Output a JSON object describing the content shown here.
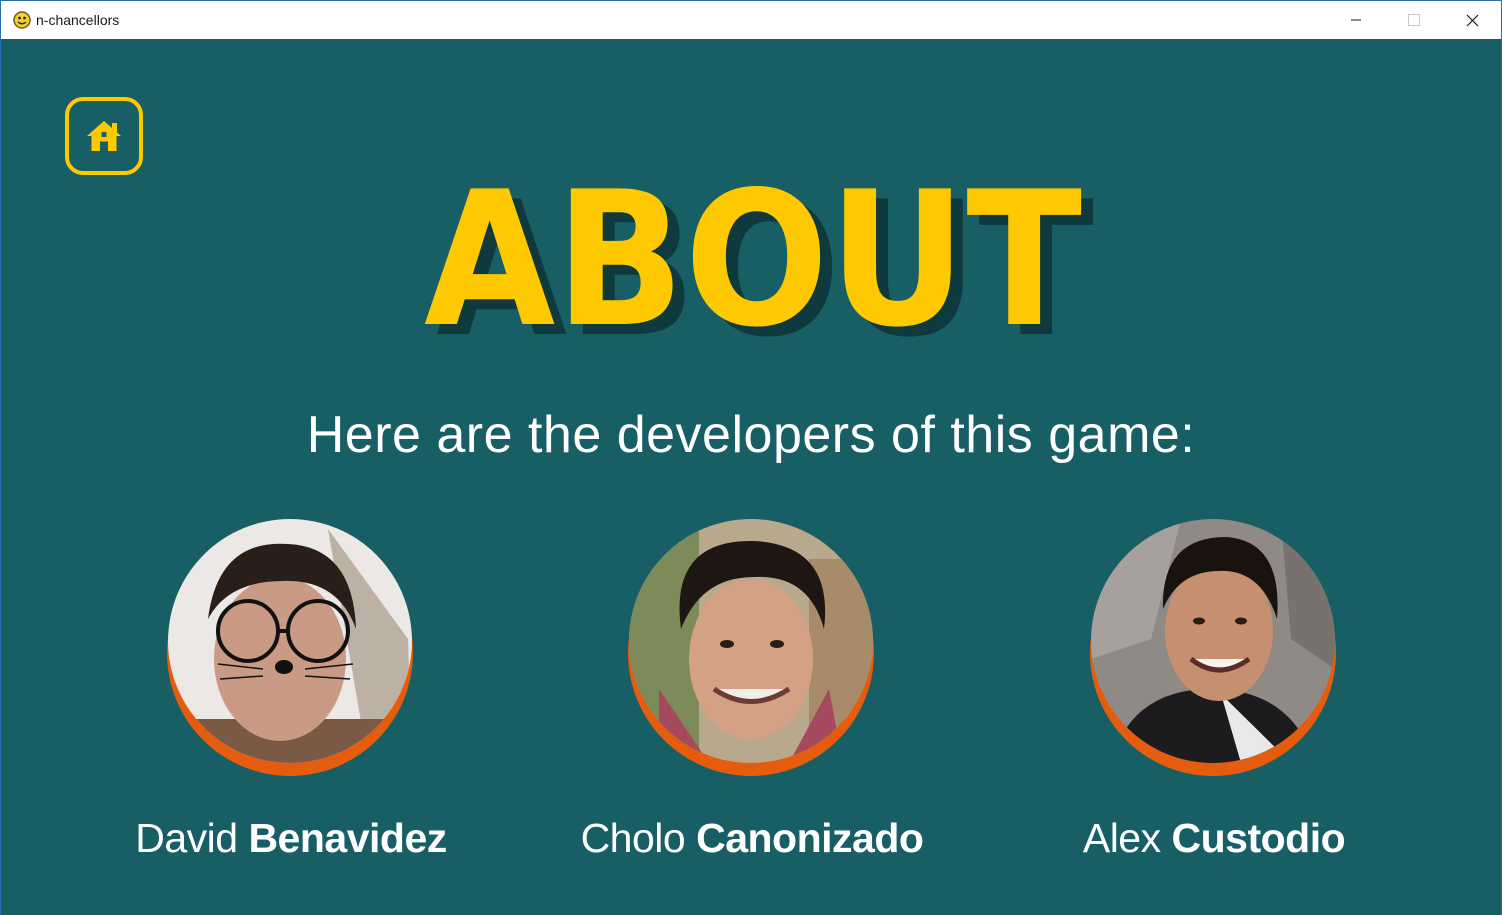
{
  "window": {
    "title": "n-chancellors",
    "app_icon": "python-snake-icon",
    "controls": {
      "minimize": "minimize-icon",
      "maximize": "maximize-icon",
      "close": "close-icon"
    }
  },
  "colors": {
    "background": "#185f65",
    "accent": "#ffc901",
    "title_shadow": "#0e3a3d",
    "avatar_ring": "#e55c0e",
    "text": "#ffffff"
  },
  "home_button": {
    "icon": "home-icon"
  },
  "page": {
    "title": "ABOUT",
    "subtitle": "Here are the developers of this game:"
  },
  "developers": [
    {
      "first_name": "David",
      "last_name": "Benavidez"
    },
    {
      "first_name": "Cholo",
      "last_name": "Canonizado"
    },
    {
      "first_name": "Alex",
      "last_name": "Custodio"
    }
  ]
}
